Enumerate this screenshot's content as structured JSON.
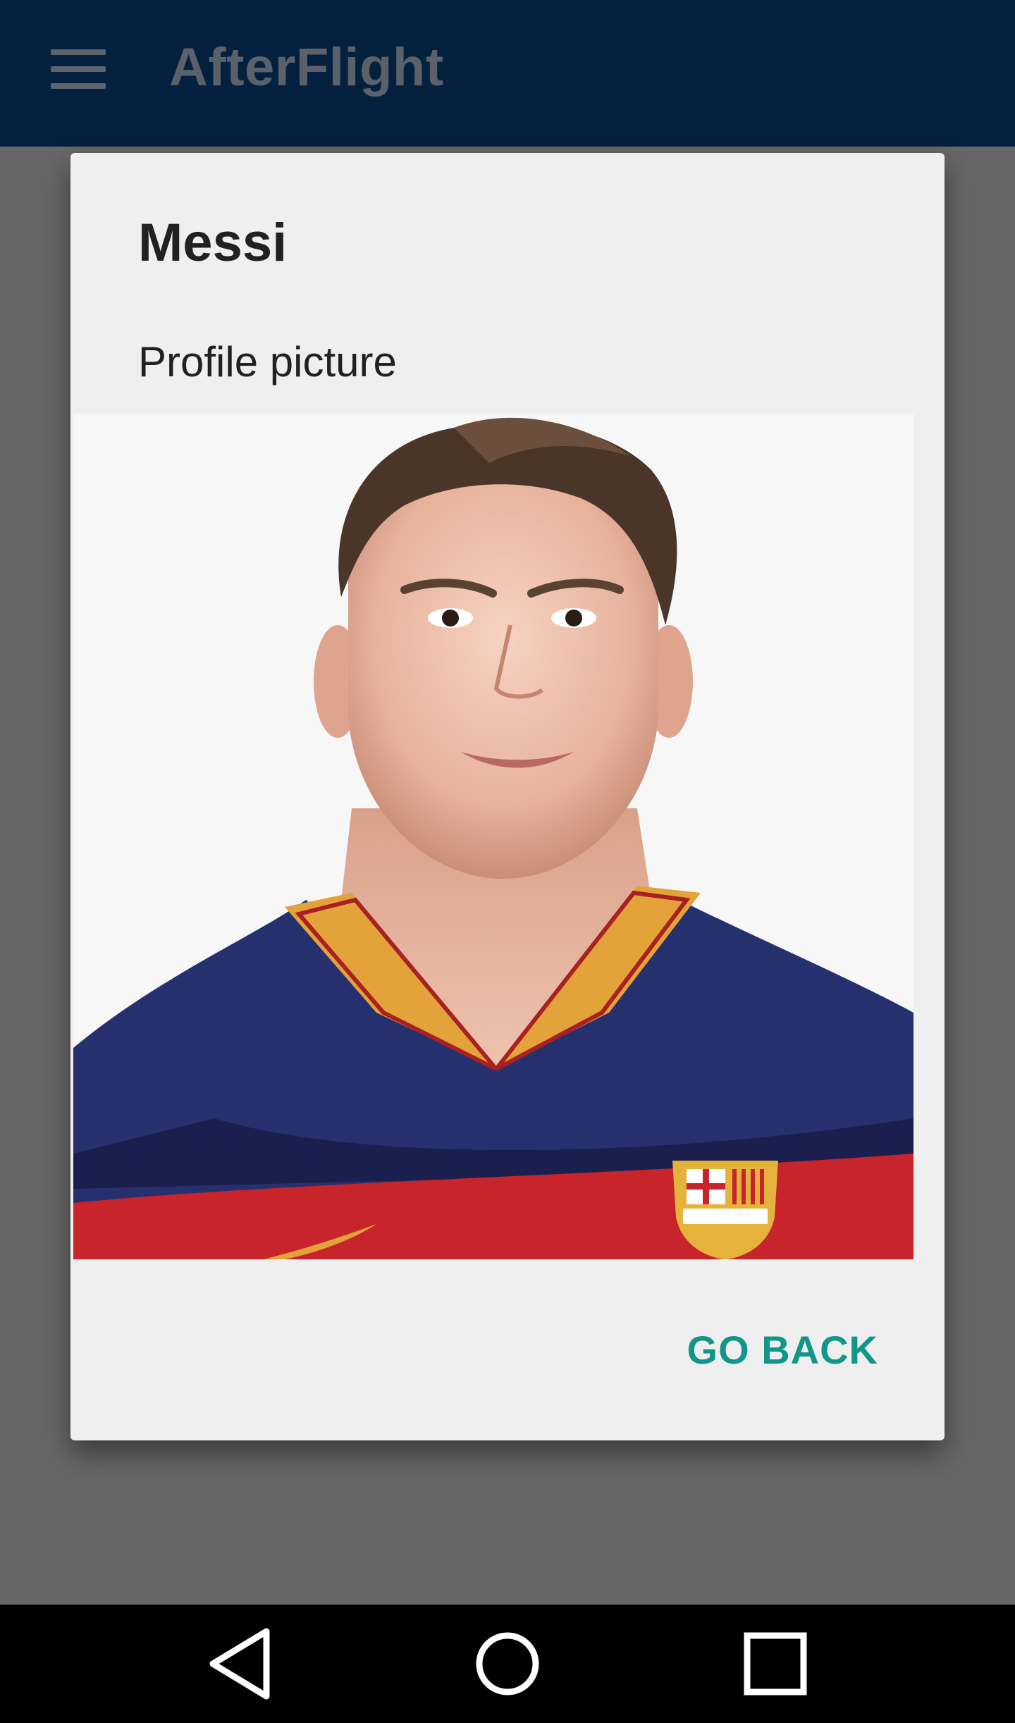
{
  "app_bar": {
    "title": "AfterFlight",
    "menu_icon": "hamburger-menu-icon"
  },
  "dialog": {
    "title": "Messi",
    "subtitle": "Profile picture",
    "go_back_label": "GO BACK"
  },
  "colors": {
    "app_bar": "#04203f",
    "scrim": "#676767",
    "dialog_background": "#efefef",
    "accent": "#11968a",
    "nav_bar": "#000000"
  },
  "nav_bar": {
    "back_icon": "back-triangle-icon",
    "home_icon": "home-circle-icon",
    "recents_icon": "recents-square-icon"
  }
}
